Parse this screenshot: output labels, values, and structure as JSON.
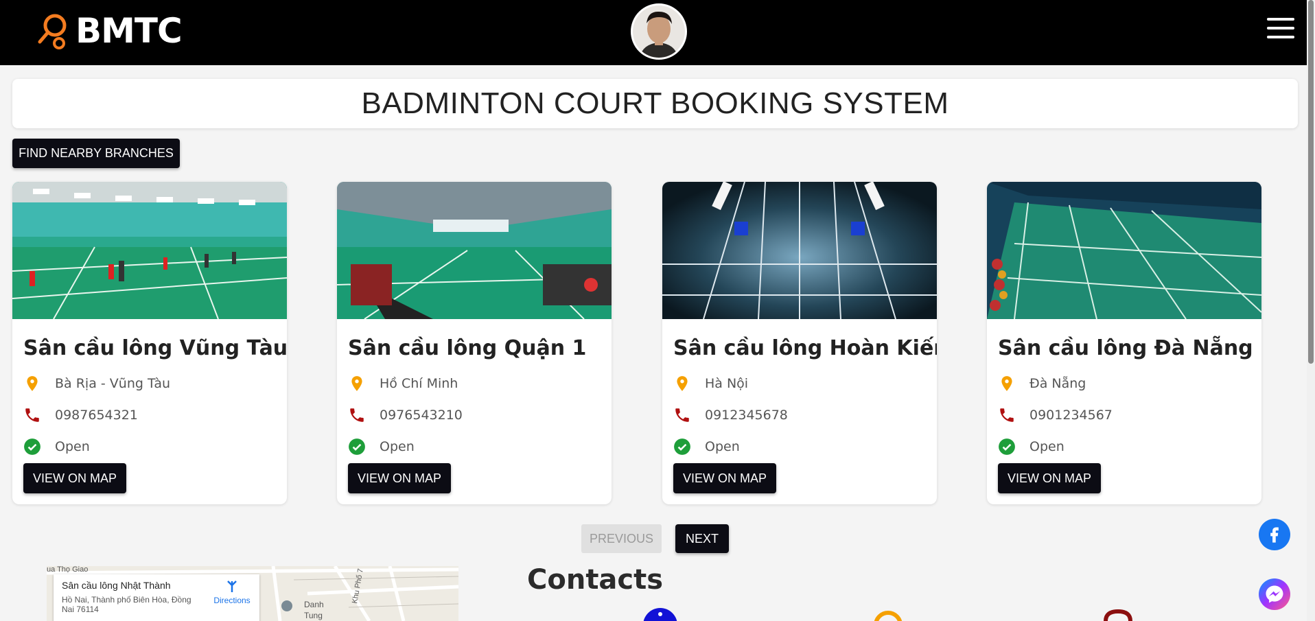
{
  "header": {
    "brand": "BMTC",
    "avatar_alt": "user avatar",
    "menu_icon": "hamburger-icon"
  },
  "page_title": "BADMINTON COURT BOOKING SYSTEM",
  "find_button": "FIND NEARBY BRANCHES",
  "branches": [
    {
      "name": "Sân cầu lông Vũng Tàu",
      "location": "Bà Rịa - Vũng Tàu",
      "phone": "0987654321",
      "status": "Open",
      "button": "VIEW ON MAP"
    },
    {
      "name": "Sân cầu lông Quận 1",
      "location": "Hồ Chí Minh",
      "phone": "0976543210",
      "status": "Open",
      "button": "VIEW ON MAP"
    },
    {
      "name": "Sân cầu lông Hoàn Kiếm",
      "location": "Hà Nội",
      "phone": "0912345678",
      "status": "Open",
      "button": "VIEW ON MAP"
    },
    {
      "name": "Sân cầu lông Đà Nẵng",
      "location": "Đà Nẵng",
      "phone": "0901234567",
      "status": "Open",
      "button": "VIEW ON MAP"
    }
  ],
  "pagination": {
    "previous": "PREVIOUS",
    "next": "NEXT"
  },
  "map": {
    "place_name": "Sân cầu lông Nhật Thành",
    "address": "Hồ Nai, Thành phố Biên Hòa, Đồng Nai 76114",
    "directions": "Directions",
    "street_labels": [
      "ua Thọ Giao",
      "Khu Phố 7",
      "Danh",
      "Tung"
    ]
  },
  "contacts_title": "Contacts",
  "colors": {
    "header_bg": "#000000",
    "logo_accent": "#f47c20",
    "location_icon": "#f5a000",
    "phone_icon": "#b01010",
    "status_icon": "#1e9e3a",
    "button_dark": "#0c0c14"
  }
}
